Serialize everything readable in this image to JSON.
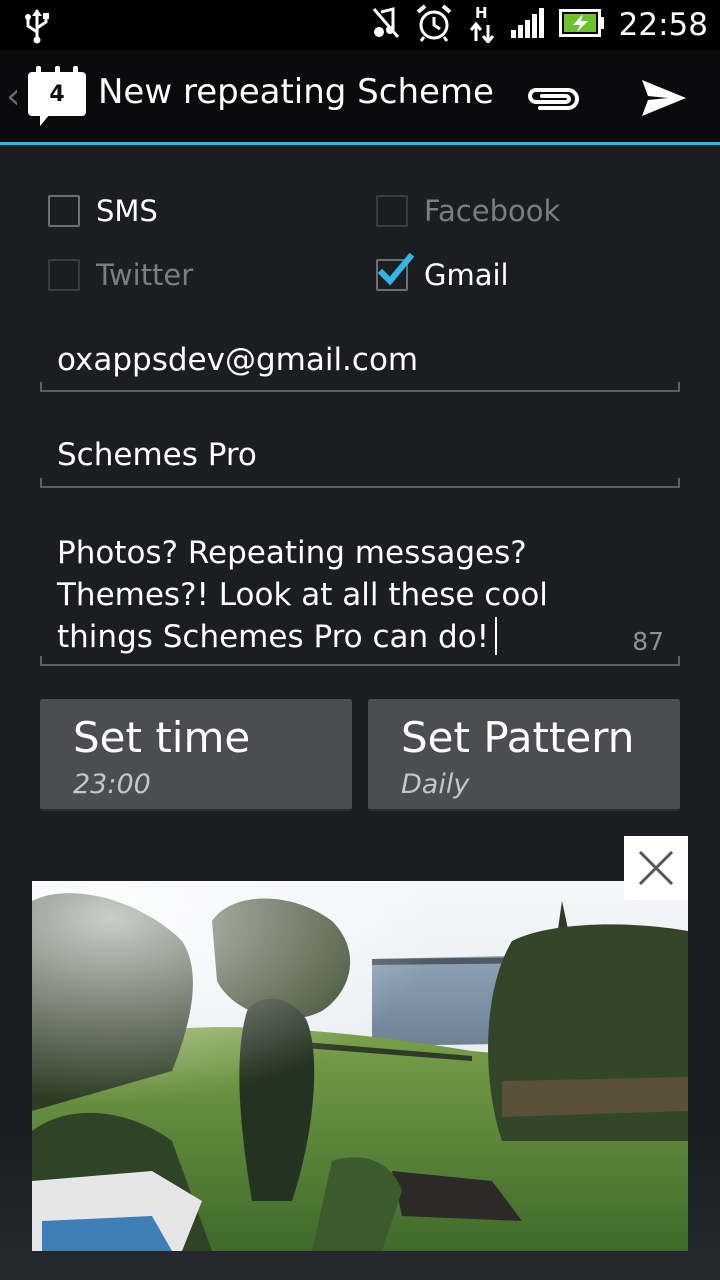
{
  "status_bar": {
    "time": "22:58",
    "icons": [
      "usb-icon",
      "mute-icon",
      "alarm-icon",
      "hspa-icon",
      "signal-icon",
      "battery-charging-icon"
    ]
  },
  "action_bar": {
    "app_icon_badge": "4",
    "title": "New repeating Scheme",
    "accent_color": "#33b5e5"
  },
  "channels": [
    {
      "label": "SMS",
      "checked": false,
      "enabled": true
    },
    {
      "label": "Facebook",
      "checked": false,
      "enabled": false
    },
    {
      "label": "Twitter",
      "checked": false,
      "enabled": false
    },
    {
      "label": "Gmail",
      "checked": true,
      "enabled": true
    }
  ],
  "form": {
    "recipient": "oxappsdev@gmail.com",
    "subject": "Schemes Pro",
    "message": "Photos? Repeating messages? Themes?! Look at all these cool things Schemes Pro can do!",
    "message_lines": [
      "Photos? Repeating messages?",
      "Themes?! Look at all these cool",
      "things Schemes Pro can do!"
    ],
    "char_count": "87"
  },
  "buttons": {
    "time": {
      "label": "Set time",
      "value": "23:00"
    },
    "pattern": {
      "label": "Set Pattern",
      "value": "Daily"
    }
  }
}
